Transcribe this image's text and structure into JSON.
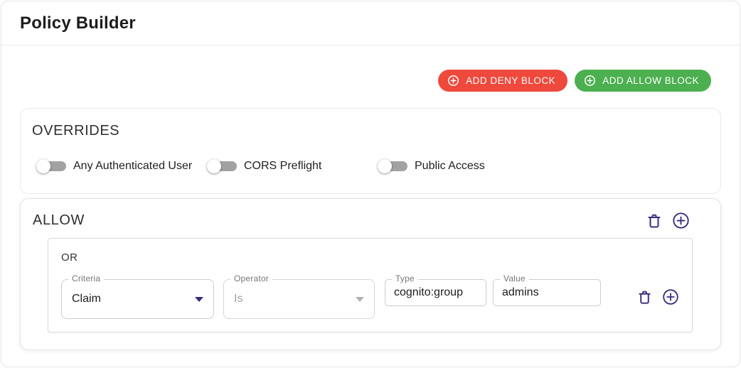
{
  "header": {
    "title": "Policy Builder"
  },
  "toolbar": {
    "add_deny_label": "ADD DENY BLOCK",
    "add_allow_label": "ADD ALLOW BLOCK"
  },
  "overrides": {
    "title": "OVERRIDES",
    "toggles": [
      {
        "label": "Any Authenticated User",
        "state": "off"
      },
      {
        "label": "CORS Preflight",
        "state": "off"
      },
      {
        "label": "Public Access",
        "state": "off"
      }
    ]
  },
  "allow_block": {
    "title": "ALLOW",
    "group": {
      "operator_label": "OR",
      "rule": {
        "criteria": {
          "label": "Criteria",
          "value": "Claim"
        },
        "operator": {
          "label": "Operator",
          "value": "Is",
          "disabled": true
        },
        "type": {
          "label": "Type",
          "value": "cognito:group"
        },
        "value": {
          "label": "Value",
          "value": "admins"
        }
      }
    }
  },
  "colors": {
    "deny_red": "#ee493c",
    "allow_green": "#4caf50",
    "icon_purple": "#3a2b7e",
    "toggle_track_gray": "#a2a2a2"
  },
  "icons": {
    "button_plus": "plus-circle-icon",
    "delete": "trash-icon",
    "add_rule": "plus-circle-icon"
  }
}
